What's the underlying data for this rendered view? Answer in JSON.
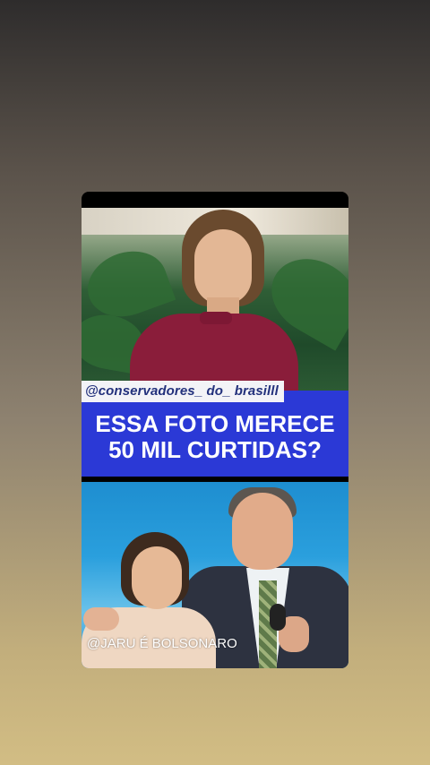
{
  "post": {
    "handle": "@conservadores_ do_ brasilll",
    "headline_line1": "ESSA FOTO MERECE",
    "headline_line2": "50 MIL CURTIDAS?",
    "watermark": "@JARU É BOLSONARO"
  },
  "colors": {
    "headline_bg": "#2b39d6",
    "headline_text": "#ffffff",
    "handle_bg": "#f3f3f7",
    "handle_text": "#23317c",
    "top_garment": "#8a1d3a"
  }
}
